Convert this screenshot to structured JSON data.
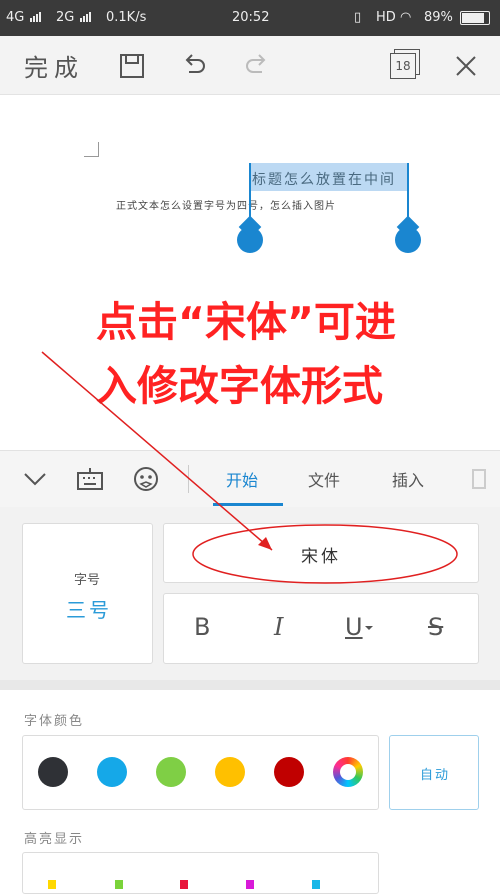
{
  "status_bar": {
    "net1": "4G",
    "net2": "2G",
    "speed": "0.1K/s",
    "time": "20:52",
    "hd": "HD",
    "battery": "89%"
  },
  "toolbar": {
    "done_label": "完成",
    "window_count": "18"
  },
  "document": {
    "selected_heading": "标题怎么放置在中间",
    "body_text": "正式文本怎么设置字号为四号，怎么插入图片"
  },
  "annotation": {
    "line1": "点击“宋体”可进",
    "line2": "入修改字体形式"
  },
  "tabs": [
    "开始",
    "文件",
    "插入"
  ],
  "font_panel": {
    "size_label": "字号",
    "size_value": "三号",
    "font_name": "宋体",
    "bold": "B",
    "italic": "I",
    "underline": "U",
    "strike": "S"
  },
  "color_section": {
    "label": "字体颜色",
    "colors": [
      "#2f3136",
      "#15a8e8",
      "#7fcf45",
      "#ffc000",
      "#c00000"
    ],
    "auto_label": "自动"
  },
  "highlight_section": {
    "label": "高亮显示"
  },
  "accent_color": "#1a86d0"
}
